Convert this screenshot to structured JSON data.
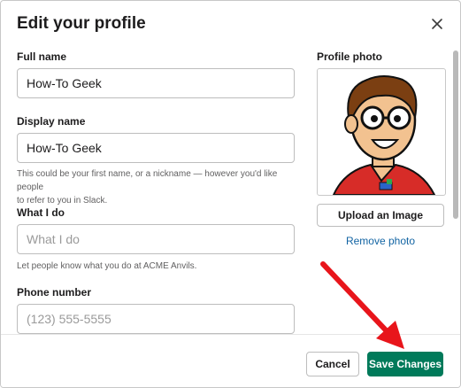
{
  "dialog": {
    "title": "Edit your profile",
    "close_icon": "close-icon"
  },
  "form": {
    "full_name": {
      "label": "Full name",
      "value": "How-To Geek"
    },
    "display_name": {
      "label": "Display name",
      "value": "How-To Geek",
      "hint_line1": "This could be your first name, or a nickname — however you'd like people",
      "hint_line2": "to refer to you in Slack."
    },
    "what_i_do": {
      "label": "What I do",
      "placeholder": "What I do",
      "hint": "Let people know what you do at ACME Anvils."
    },
    "phone": {
      "label": "Phone number",
      "placeholder": "(123) 555-5555"
    }
  },
  "photo": {
    "label": "Profile photo",
    "upload_label": "Upload an Image",
    "remove_label": "Remove photo"
  },
  "footer": {
    "cancel_label": "Cancel",
    "save_label": "Save Changes"
  },
  "colors": {
    "primary": "#007a5a",
    "link": "#1264a3",
    "annotation_arrow": "#e8151b"
  }
}
